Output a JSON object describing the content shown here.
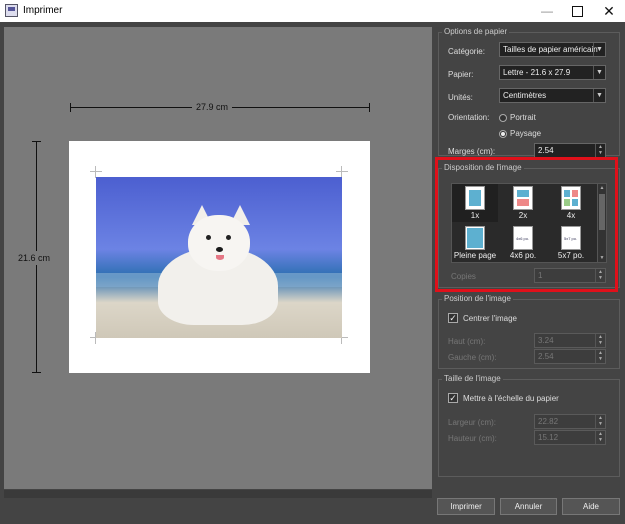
{
  "window": {
    "title": "Imprimer"
  },
  "preview": {
    "width_label": "27.9 cm",
    "height_label": "21.6 cm"
  },
  "paper_options": {
    "title": "Options de papier",
    "category_label": "Catégorie:",
    "category_value": "Tailles de papier américain",
    "paper_label": "Papier:",
    "paper_value": "Lettre - 21.6 x 27.9",
    "units_label": "Unités:",
    "units_value": "Centimètres",
    "orientation_label": "Orientation:",
    "portrait_label": "Portrait",
    "landscape_label": "Paysage",
    "orientation_selected": "Paysage",
    "margins_label": "Marges (cm):",
    "margins_value": "2.54"
  },
  "image_layout": {
    "title": "Disposition de l'image",
    "items": [
      "1x",
      "2x",
      "4x",
      "Pleine page",
      "4x6 po.",
      "5x7 po."
    ],
    "selected": "1x",
    "thumb_4x6": "4x6 po.",
    "thumb_5x7": "5x7 po.",
    "copies_label": "Copies",
    "copies_value": "1"
  },
  "image_position": {
    "title": "Position de l'image",
    "center_label": "Centrer l'image",
    "center_checked": true,
    "top_label": "Haut (cm):",
    "top_value": "3.24",
    "left_label": "Gauche (cm):",
    "left_value": "2.54"
  },
  "image_size": {
    "title": "Taille de l'image",
    "fit_label": "Mettre à l'échelle du papier",
    "fit_checked": true,
    "width_label": "Largeur (cm):",
    "width_value": "22.82",
    "height_label": "Hauteur (cm):",
    "height_value": "15.12"
  },
  "buttons": {
    "print": "Imprimer",
    "cancel": "Annuler",
    "help": "Aide"
  },
  "colors": {
    "highlight": "#e0101a",
    "dialog_bg": "#444444",
    "preview_bg": "#7a7a7a"
  }
}
